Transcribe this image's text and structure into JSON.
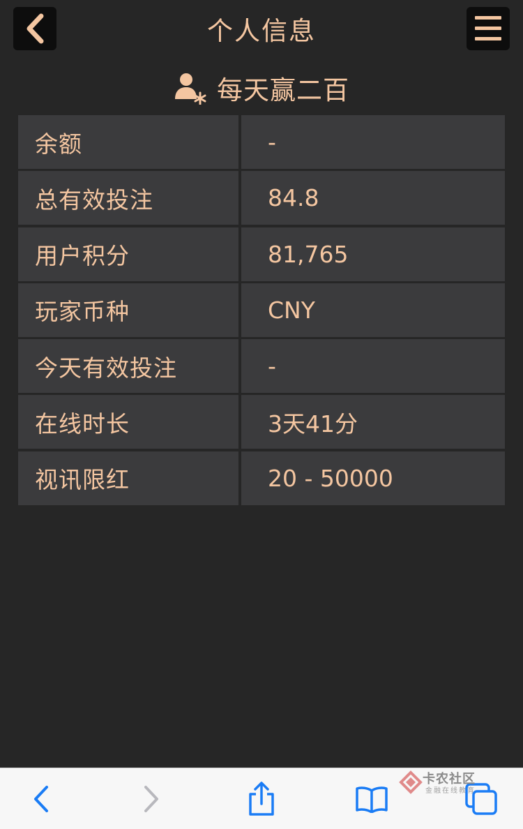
{
  "header": {
    "title": "个人信息",
    "back_icon": "chevron-left-icon",
    "menu_icon": "hamburger-menu-icon"
  },
  "user": {
    "name": "每天赢二百",
    "icon": "user-settings-icon"
  },
  "info_rows": [
    {
      "label": "余额",
      "value": "-"
    },
    {
      "label": "总有效投注",
      "value": "84.8"
    },
    {
      "label": "用户积分",
      "value": "81,765"
    },
    {
      "label": "玩家币种",
      "value": "CNY"
    },
    {
      "label": "今天有效投注",
      "value": "-"
    },
    {
      "label": "在线时长",
      "value": "3天41分"
    },
    {
      "label": "视讯限红",
      "value": "20 - 50000"
    }
  ],
  "browser_toolbar": {
    "items": [
      "back-icon",
      "forward-icon",
      "share-icon",
      "bookmarks-icon",
      "tabs-icon"
    ]
  },
  "watermark": {
    "title": "卡农社区",
    "subtitle": "金融在线教育"
  },
  "colors": {
    "background": "#262626",
    "cell": "#3b3b3d",
    "accent": "#f4c6a1",
    "button_bg": "#0d0d0d",
    "toolbar_bg": "#f7f7f7",
    "toolbar_icon": "#1a7cf5"
  }
}
